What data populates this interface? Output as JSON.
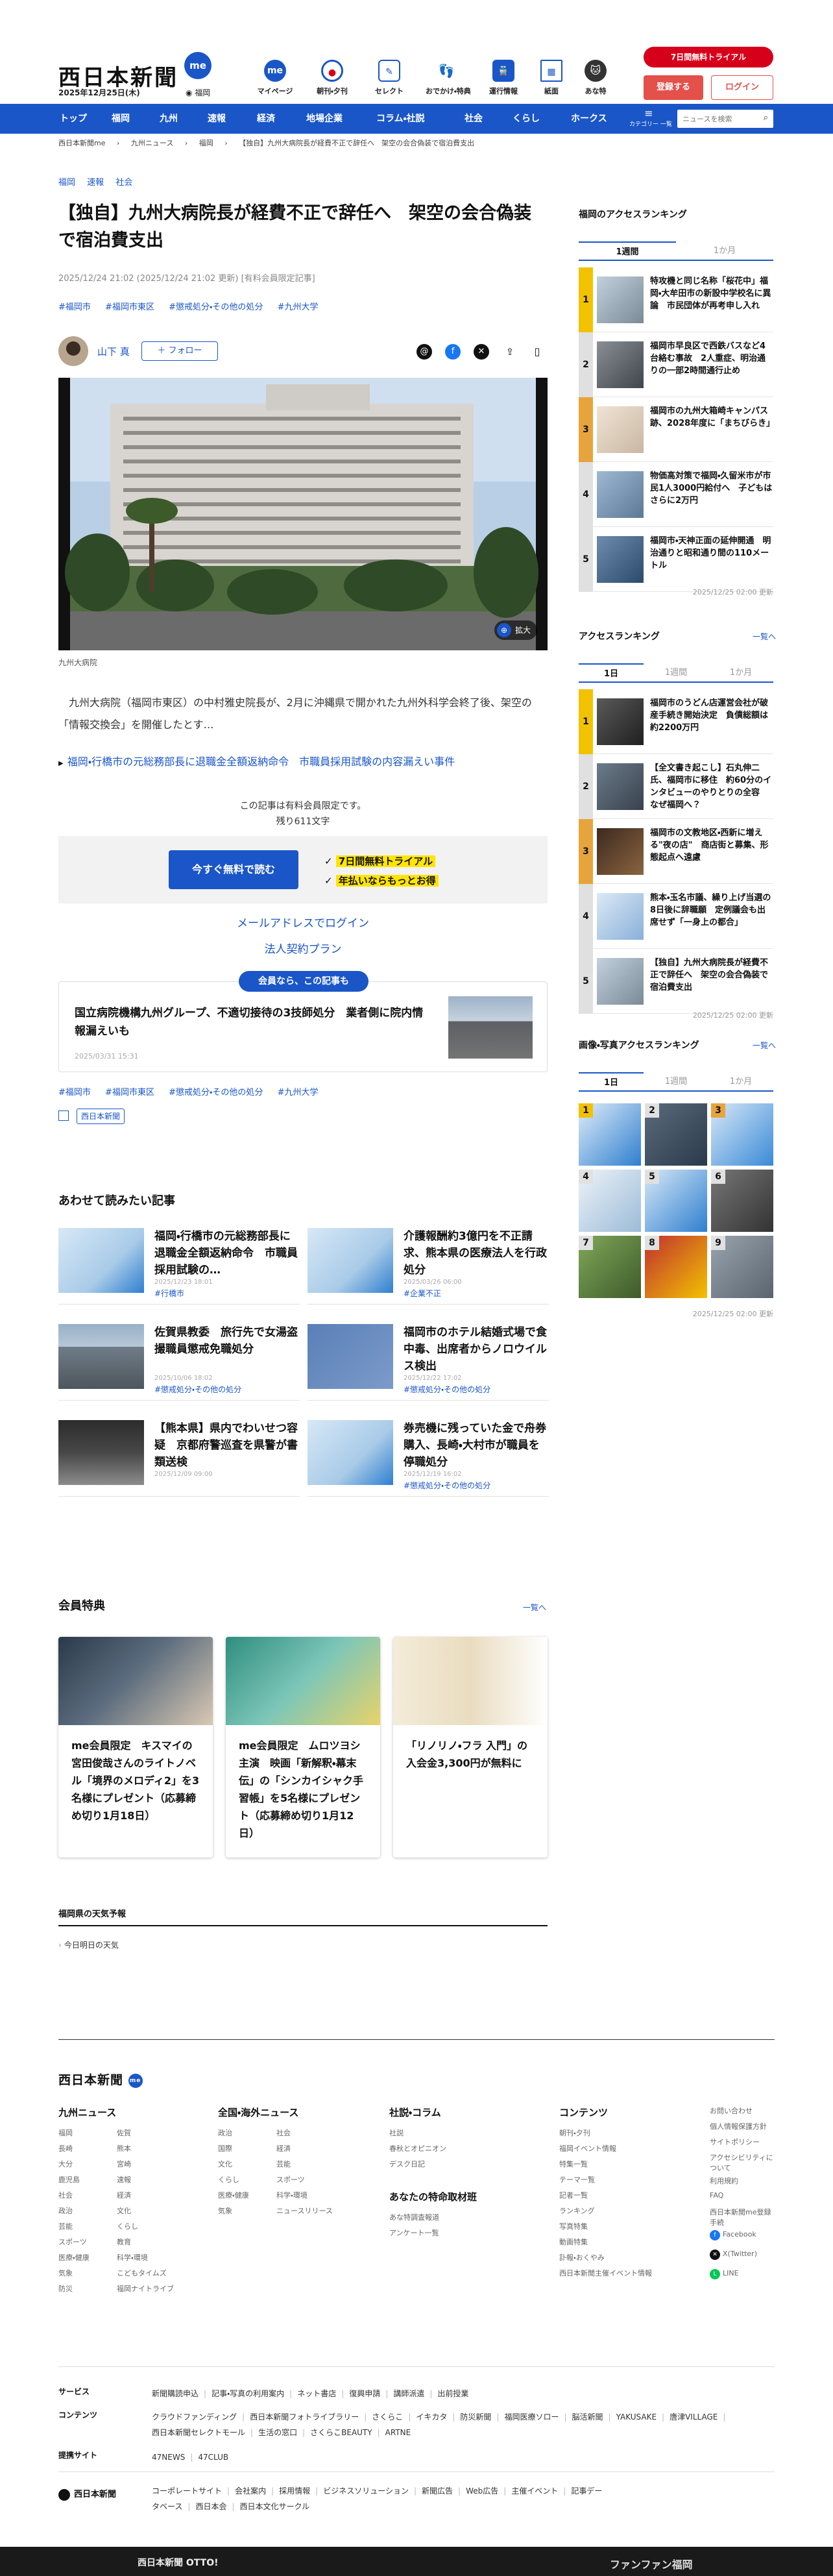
{
  "header": {
    "logo": "西日本新聞",
    "logo_badge": "me",
    "date": "2025年12月25日(木)",
    "location": "福岡",
    "nav_icons": [
      {
        "label": "マイページ",
        "icon": "me-icon",
        "color": "#1a56c8"
      },
      {
        "label": "朝刊・夕刊",
        "icon": "newspaper-icon",
        "color": "#1a56c8"
      },
      {
        "label": "セレクト",
        "icon": "select-icon",
        "color": "#1a56c8"
      },
      {
        "label": "おでかけ・特典",
        "icon": "footprints-icon",
        "color": "#1a56c8"
      },
      {
        "label": "運行情報",
        "icon": "train-icon",
        "color": "#1a56c8"
      },
      {
        "label": "紙面",
        "icon": "paper-icon",
        "color": "#1a56c8"
      },
      {
        "label": "あな特",
        "icon": "mascot-icon",
        "color": "#333333"
      }
    ],
    "trial_label": "7日間無料トライアル",
    "register_label": "登録する",
    "login_label": "ログイン"
  },
  "gnav": {
    "items": [
      "トップ",
      "福岡",
      "九州",
      "速報",
      "経済",
      "地場企業",
      "コラム・社説",
      "社会",
      "くらし",
      "ホークス"
    ],
    "category_label": "カテゴリー 一覧",
    "search_placeholder": "ニュースを検索"
  },
  "breadcrumb": [
    "西日本新聞me",
    "九州ニュース",
    "福岡",
    "【独自】九州大病院長が経費不正で辞任へ　架空の会合偽装で宿泊費支出"
  ],
  "article": {
    "categories": [
      "福岡",
      "速報",
      "社会"
    ],
    "title": "【独自】九州大病院長が経費不正で辞任へ　架空の会合偽装で宿泊費支出",
    "meta": "2025/12/24 21:02 (2025/12/24 21:02 更新) [有料会員限定記事]",
    "tags_top": [
      "#福岡市",
      "#福岡市東区",
      "#懲戒処分・その他の処分",
      "#九州大学"
    ],
    "author": "山下 真",
    "follow_label": "＋ フォロー",
    "expand_label": "拡大",
    "photo_caption": "九州大病院",
    "lead": "　九州大病院（福岡市東区）の中村雅史院長が、2月に沖縄県で開かれた九州外科学会終了後、架空の「情報交換会」を開催したとす…",
    "related_link": "福岡・行橋市の元総務部長に退職金全額返納命令　市職員採用試験の内容漏えい事件",
    "paywall_note_1": "この記事は有料会員限定です。",
    "paywall_note_2": "残り611文字",
    "read_free_label": "今すぐ無料で読む",
    "perk_1": "7日間無料トライアル",
    "perk_2": "年払いならもっとお得",
    "mail_login_label": "メールアドレスでログイン",
    "corp_label": "法人契約プラン",
    "member_pill": "会員なら、この記事も",
    "member_card_title": "国立病院機構九州グループ、不適切接待の3技師処分　業者側に院内情報漏えいも",
    "member_card_date": "2025/03/31 15:31",
    "tags_bottom": [
      "#福岡市",
      "#福岡市東区",
      "#懲戒処分・その他の処分",
      "#九州大学"
    ],
    "publisher_tag": "西日本新聞"
  },
  "also_read": {
    "title": "あわせて読みたい記事",
    "items": [
      {
        "title": "福岡・行橋市の元総務部長に退職金全額返納命令　市職員採用試験の…",
        "date": "2025/12/23 18:01",
        "tag": "#行橋市",
        "img": "map-blue"
      },
      {
        "title": "介護報酬約3億円を不正請求、熊本県の医療法人を行政処分",
        "date": "2025/03/26 06:00",
        "tag": "#企業不正",
        "img": "map-blue"
      },
      {
        "title": "佐賀県教委　旅行先で女湯盗撮職員懲戒免職処分",
        "date": "2025/10/06 18:02",
        "tag": "#懲戒処分・その他の処分",
        "img": "building"
      },
      {
        "title": "福岡市のホテル結婚式場で食中毒、出席者からノロウイルス検出",
        "date": "2025/12/22 17:02",
        "tag": "#懲戒処分・その他の処分",
        "img": "food"
      },
      {
        "title": "【熊本県】県内でわいせつ容疑　京都府警巡査を県警が書類送検",
        "date": "2025/12/09 09:00",
        "tag": "",
        "img": "station"
      },
      {
        "title": "券売機に残っていた金で舟券購入、長崎・大村市が職員を停職処分",
        "date": "2025/12/19 16:02",
        "tag": "#懲戒処分・その他の処分",
        "img": "map-blue"
      }
    ]
  },
  "member_perks": {
    "title": "会員特典",
    "more_label": "一覧へ",
    "items": [
      {
        "title": "me会員限定　キスマイの宮田俊哉さんのライトノベル「境界のメロディ2」を3名様にプレゼント（応募締め切り1月18日）"
      },
      {
        "title": "me会員限定　ムロツヨシ主演　映画「新解釈・幕末伝」の「シンカイシャク手習帳」を5名様にプレゼント（応募締め切り1月12日）"
      },
      {
        "title": "「リノリノ・フラ 入門」の入会金3,300円が無料に"
      }
    ]
  },
  "weather": {
    "title": "福岡県の天気予報",
    "link": "今日明日の天気"
  },
  "sidebar": {
    "fukuoka_rank": {
      "title": "福岡のアクセスランキング",
      "tabs": [
        "1週間",
        "1か月"
      ],
      "items": [
        {
          "rank": "1",
          "title": "特攻機と同じ名称「桜花中」福岡・大牟田市の新設中学校名に異論　市民団体が再考申し入れ"
        },
        {
          "rank": "2",
          "title": "福岡市早良区で西鉄バスなど4台絡む事故　2人重症、明治通りの一部2時間通行止め"
        },
        {
          "rank": "3",
          "title": "福岡市の九州大箱崎キャンパス跡、2028年度に「まちびらき」"
        },
        {
          "rank": "4",
          "title": "物価高対策で福岡・久留米市が市民1人3000円給付へ　子どもはさらに2万円"
        },
        {
          "rank": "5",
          "title": "福岡市・天神正面の延伸開通　明治通りと昭和通り間の110メートル"
        }
      ],
      "updated": "2025/12/25 02:00 更新"
    },
    "access_rank": {
      "title": "アクセスランキング",
      "more_label": "一覧へ",
      "tabs": [
        "1日",
        "1週間",
        "1か月"
      ],
      "items": [
        {
          "rank": "1",
          "title": "福岡市のうどん店運営会社が破産手続き開始決定　負債総額は約2200万円"
        },
        {
          "rank": "2",
          "title": "【全文書き起こし】石丸伸二氏、福岡市に移住　約60分のインタビューのやりとりの全容　なぜ福岡へ？"
        },
        {
          "rank": "3",
          "title": "福岡市の文教地区・西新に増える\"夜の店\"　商店街と募集、形態起点へ遠慮"
        },
        {
          "rank": "4",
          "title": "熊本・玉名市議、繰り上げ当選の8日後に辞職願　定例議会も出席せず「一身上の都合」"
        },
        {
          "rank": "5",
          "title": "【独自】九州大病院長が経費不正で辞任へ　架空の会合偽装で宿泊費支出"
        }
      ],
      "updated": "2025/12/25 02:00 更新"
    },
    "photo_rank": {
      "title": "画像・写真アクセスランキング",
      "more_label": "一覧へ",
      "tabs": [
        "1日",
        "1週間",
        "1か月"
      ],
      "ranks": [
        "1",
        "2",
        "3",
        "4",
        "5",
        "6",
        "7",
        "8",
        "9"
      ],
      "updated": "2025/12/25 02:00 更新"
    }
  },
  "footer": {
    "logo": "西日本新聞",
    "logo_badge": "me",
    "cols": [
      {
        "heading": "九州ニュース",
        "items": [
          "福岡",
          "佐賀",
          "長崎",
          "熊本",
          "大分",
          "宮崎",
          "鹿児島",
          "速報",
          "社会",
          "経済",
          "政治",
          "文化",
          "芸能",
          "くらし",
          "スポーツ",
          "教育",
          "医療・健康",
          "科学・環境",
          "気象",
          "こどもタイムズ",
          "防災",
          "福岡ナイトライブ"
        ]
      },
      {
        "heading": "全国・海外ニュース",
        "items": [
          "政治",
          "社会",
          "国際",
          "経済",
          "文化",
          "芸能",
          "くらし",
          "スポーツ",
          "医療・健康",
          "科学・環境",
          "気象",
          "ニュースリリース"
        ]
      },
      {
        "heading": "社説・コラム",
        "items": [
          "社説",
          "春秋とオピニオン",
          "デスク日記"
        ]
      },
      {
        "heading": "あなたの特命取材班",
        "items": [
          "あな特調査報道",
          "アンケート一覧"
        ]
      },
      {
        "heading": "コンテンツ",
        "items": [
          "朝刊・夕刊",
          "福岡イベント情報",
          "特集一覧",
          "テーマ一覧",
          "記者一覧",
          "ランキング",
          "写真特集",
          "動画特集",
          "訃報・おくやみ",
          "西日本新聞主催イベント情報"
        ]
      },
      {
        "heading": "",
        "items": [
          "お問い合わせ",
          "個人情報保護方針",
          "サイトポリシー",
          "アクセシビリティについて",
          "利用規約",
          "FAQ",
          "西日本新聞me登録手続",
          "Facebook",
          "X(Twitter)",
          "LINE"
        ]
      }
    ],
    "service_rows": [
      {
        "label": "サービス",
        "items": [
          "新聞購読申込",
          "記事・写真の利用案内",
          "ネット書店",
          "復興申請",
          "講師派遣",
          "出前授業"
        ]
      },
      {
        "label": "コンテンツ",
        "items": [
          "クラウドファンディング",
          "西日本新聞フォトライブラリー",
          "さくらこ",
          "イキカタ",
          "防災新聞",
          "福岡医療ソロー",
          "脳活新聞",
          "YAKUSAKE",
          "唐津VILLAGE",
          "西日本新聞セレクトモール",
          "生活の窓口",
          "さくらこBEAUTY",
          "ARTNE"
        ]
      },
      {
        "label": "提携サイト",
        "items": [
          "47NEWS",
          "47CLUB"
        ]
      }
    ],
    "company_label": "西日本新聞",
    "company_links": [
      "コーポレートサイト",
      "会社案内",
      "採用情報",
      "ビジネスソリューション",
      "新聞広告",
      "Web広告",
      "主催イベント",
      "記事データベース",
      "西日本会",
      "西日本文化サークル"
    ],
    "bottom_left": "西日本新聞 OTTO!",
    "bottom_right": "ファンファン福岡"
  }
}
